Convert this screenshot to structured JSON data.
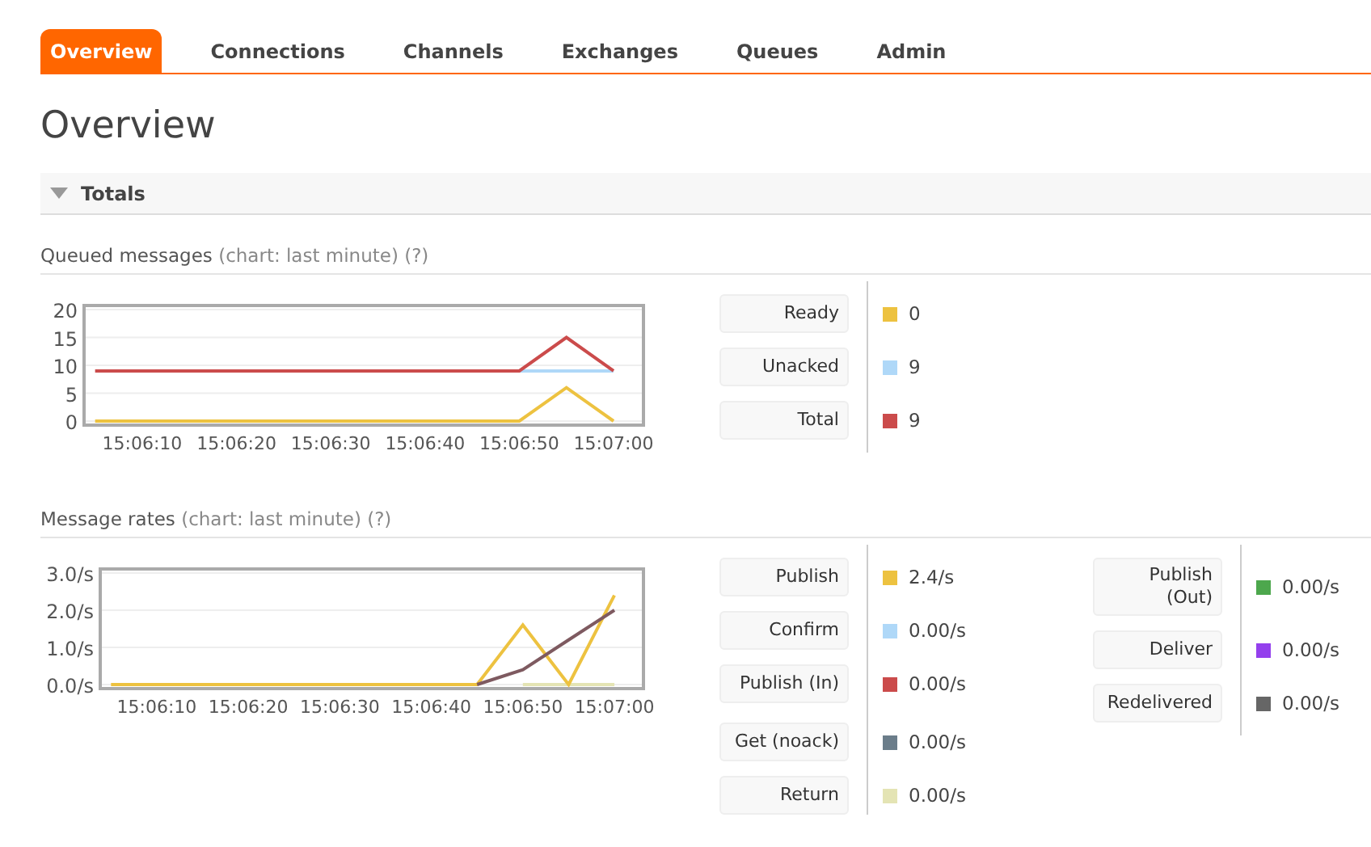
{
  "tabs": [
    {
      "label": "Overview",
      "selected": true
    },
    {
      "label": "Connections",
      "selected": false
    },
    {
      "label": "Channels",
      "selected": false
    },
    {
      "label": "Exchanges",
      "selected": false
    },
    {
      "label": "Queues",
      "selected": false
    },
    {
      "label": "Admin",
      "selected": false
    }
  ],
  "page_title": "Overview",
  "section": {
    "title": "Totals",
    "expanded": true
  },
  "queued_messages": {
    "title": "Queued messages",
    "hint": "(chart: last minute)",
    "help": "(?)",
    "chart_data": {
      "type": "line",
      "categories": [
        null,
        "15:06:10",
        null,
        "15:06:20",
        null,
        "15:06:30",
        null,
        "15:06:40",
        null,
        "15:06:50",
        null,
        "15:07:00"
      ],
      "ylim": [
        0,
        20
      ],
      "grid": true,
      "yticks": [
        0,
        5,
        10,
        15,
        20
      ],
      "series": [
        {
          "color": "#afd8f8",
          "values": [
            null,
            null,
            null,
            null,
            null,
            null,
            null,
            null,
            null,
            9,
            9,
            9
          ]
        },
        {
          "color": "#cb4b4b",
          "values": [
            9,
            9,
            9,
            9,
            9,
            9,
            9,
            9,
            9,
            9,
            15,
            9
          ]
        },
        {
          "color": "#edc240",
          "values": [
            0,
            0,
            0,
            0,
            0,
            0,
            0,
            0,
            0,
            0,
            6,
            0
          ]
        }
      ]
    },
    "columns": [
      {
        "groups": [
          {
            "items": [
              {
                "label": "Ready",
                "color": "#edc240",
                "value": "0"
              },
              {
                "label": "Unacked",
                "color": "#afd8f8",
                "value": "9"
              },
              {
                "label": "Total",
                "color": "#cb4b4b",
                "value": "9"
              }
            ]
          }
        ]
      }
    ]
  },
  "message_rates": {
    "title": "Message rates",
    "hint": "(chart: last minute)",
    "help": "(?)",
    "chart_data": {
      "type": "line",
      "categories": [
        null,
        "15:06:10",
        null,
        "15:06:20",
        null,
        "15:06:30",
        null,
        "15:06:40",
        null,
        "15:06:50",
        null,
        "15:07:00"
      ],
      "ylim": [
        0,
        3
      ],
      "grid": true,
      "yticks": [
        {
          "value": 0,
          "label": "0.0/s"
        },
        {
          "value": 1,
          "label": "1.0/s"
        },
        {
          "value": 2,
          "label": "2.0/s"
        },
        {
          "value": 3,
          "label": "3.0/s"
        }
      ],
      "series": [
        {
          "color": "#e4e4b4",
          "values": [
            null,
            null,
            null,
            null,
            null,
            null,
            null,
            null,
            null,
            0,
            0,
            0
          ]
        },
        {
          "color": "#edc240",
          "values": [
            0,
            0,
            0,
            0,
            0,
            0,
            0,
            0,
            0,
            1.6,
            0,
            2.4
          ]
        },
        {
          "color": "#7e5a60",
          "values": [
            null,
            null,
            null,
            null,
            null,
            null,
            null,
            null,
            0,
            0.4,
            1.2,
            2.0
          ]
        }
      ]
    },
    "columns": [
      {
        "groups": [
          {
            "items": [
              {
                "label": "Publish",
                "color": "#edc240",
                "value": "2.4/s"
              },
              {
                "label": "Confirm",
                "color": "#afd8f8",
                "value": "0.00/s"
              },
              {
                "label": "Publish (In)",
                "color": "#cb4b4b",
                "value": "0.00/s"
              }
            ]
          },
          {
            "items": [
              {
                "label": "Get (noack)",
                "color": "#6b7d8a",
                "value": "0.00/s"
              },
              {
                "label": "Return",
                "color": "#e4e4b4",
                "value": "0.00/s"
              }
            ]
          }
        ]
      },
      {
        "groups": [
          {
            "items": [
              {
                "label": "Publish (Out)",
                "color": "#4da74d",
                "value": "0.00/s"
              },
              {
                "label": "Deliver",
                "color": "#9440ed",
                "value": "0.00/s"
              },
              {
                "label": "Redelivered",
                "color": "#666666",
                "value": "0.00/s"
              }
            ]
          }
        ]
      }
    ]
  }
}
